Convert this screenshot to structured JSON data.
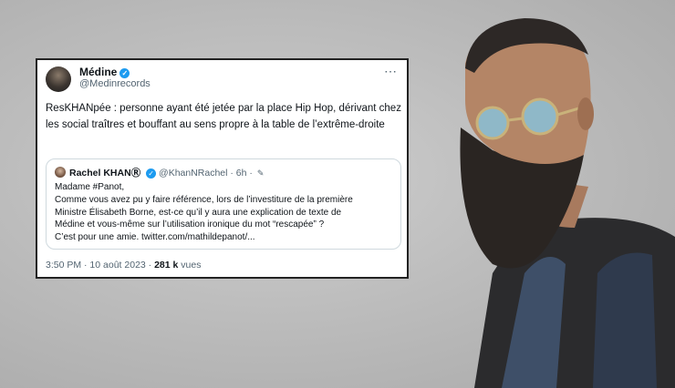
{
  "tweet": {
    "author_name": "Médine",
    "author_handle": "@Medinrecords",
    "more_icon": "⋯",
    "text": "ResKHANpée : personne ayant été jetée par la place Hip Hop, dérivant chez les social traîtres et bouffant au sens propre à la table de l’extrême-droite",
    "quote": {
      "name": "Rachel KHAN",
      "badge": "Ⓡ",
      "handle_time": "@KhanNRachel · 6h ·",
      "lines": [
        "Madame #Panot,",
        "Comme vous avez pu y faire référence, lors de l’investiture de la première",
        "Ministre Élisabeth Borne, est-ce qu’il y aura une explication de texte de",
        "Médine et vous-même sur l’utilisation ironique du mot “rescapée” ?",
        "C’est pour une amie. twitter.com/mathildepanot/..."
      ]
    },
    "timestamp": "3:50 PM · 10 août 2023 ·",
    "views_count": "281 k",
    "views_label": "vues"
  },
  "colors": {
    "verified": "#1d9bf0",
    "text": "#0f1419",
    "muted": "#536471"
  }
}
